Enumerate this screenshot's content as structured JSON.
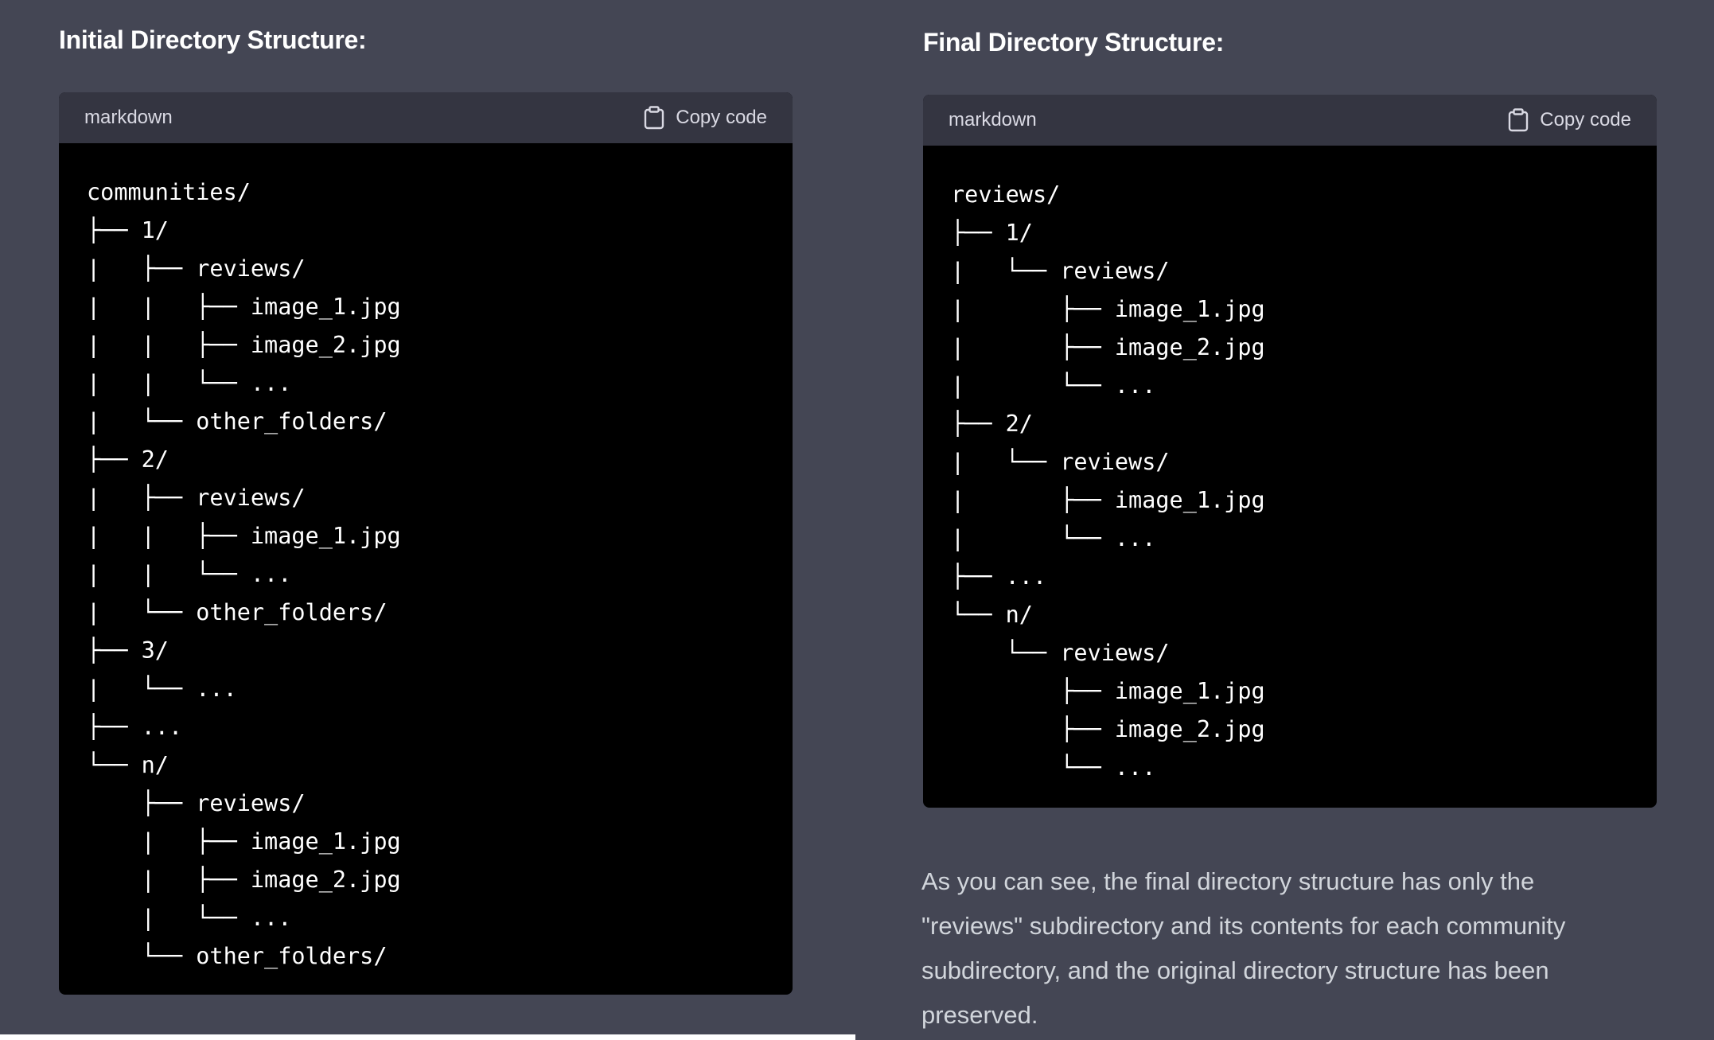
{
  "left": {
    "heading": "Initial Directory Structure:",
    "code": {
      "language": "markdown",
      "copy_label": "Copy code",
      "lines": [
        "communities/",
        "├── 1/",
        "|   ├── reviews/",
        "|   |   ├── image_1.jpg",
        "|   |   ├── image_2.jpg",
        "|   |   └── ...",
        "|   └── other_folders/",
        "├── 2/",
        "|   ├── reviews/",
        "|   |   ├── image_1.jpg",
        "|   |   └── ...",
        "|   └── other_folders/",
        "├── 3/",
        "|   └── ...",
        "├── ...",
        "└── n/",
        "    ├── reviews/",
        "    |   ├── image_1.jpg",
        "    |   ├── image_2.jpg",
        "    |   └── ...",
        "    └── other_folders/"
      ]
    }
  },
  "right": {
    "heading": "Final Directory Structure:",
    "code": {
      "language": "markdown",
      "copy_label": "Copy code",
      "lines": [
        "reviews/",
        "├── 1/",
        "|   └── reviews/",
        "|       ├── image_1.jpg",
        "|       ├── image_2.jpg",
        "|       └── ...",
        "├── 2/",
        "|   └── reviews/",
        "|       ├── image_1.jpg",
        "|       └── ...",
        "├── ...",
        "└── n/",
        "    └── reviews/",
        "        ├── image_1.jpg",
        "        ├── image_2.jpg",
        "        └── ..."
      ]
    },
    "explanation": "As you can see, the final directory structure has only the \"reviews\" subdirectory and its contents for each community subdirectory, and the original directory structure has been preserved."
  },
  "icons": {
    "copy": "clipboard-icon"
  },
  "colors": {
    "background": "#444654",
    "code_header": "#343541",
    "code_body": "#000000",
    "heading_text": "#ffffff",
    "body_text": "#d1d5db",
    "muted_text": "#d9d9e3"
  }
}
